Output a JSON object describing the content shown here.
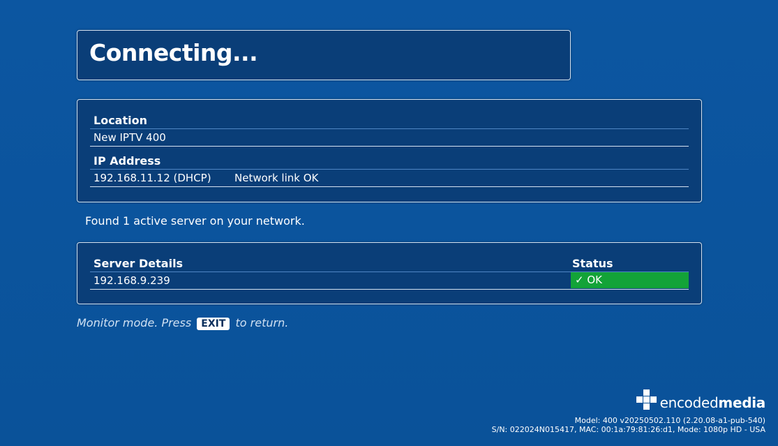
{
  "title": "Connecting...",
  "network": {
    "location_label": "Location",
    "location_value": "New IPTV 400",
    "ip_label": "IP Address",
    "ip_value": "192.168.11.12 (DHCP)",
    "link_status": "Network link OK"
  },
  "found_message": "Found 1 active server on your network.",
  "servers": {
    "details_header": "Server Details",
    "status_header": "Status",
    "rows": [
      {
        "address": "192.168.9.239",
        "status": "✓ OK",
        "status_color": "#13a338"
      }
    ]
  },
  "monitor": {
    "prefix": "Monitor mode. Press",
    "key": "EXIT",
    "suffix": "to return."
  },
  "brand": {
    "logo_icon": "encodedmedia-logo-icon",
    "name_light": "encoded",
    "name_bold": "media"
  },
  "footer": {
    "line1": "Model: 400 v20250502.110 (2.20.08-a1-pub-540)",
    "line2": "S/N: 022024N015417, MAC: 00:1a:79:81:26:d1, Mode: 1080p HD - USA"
  },
  "colors": {
    "background": "#0b55a0",
    "panel": "#0a3e78",
    "ok_green": "#13a338"
  }
}
